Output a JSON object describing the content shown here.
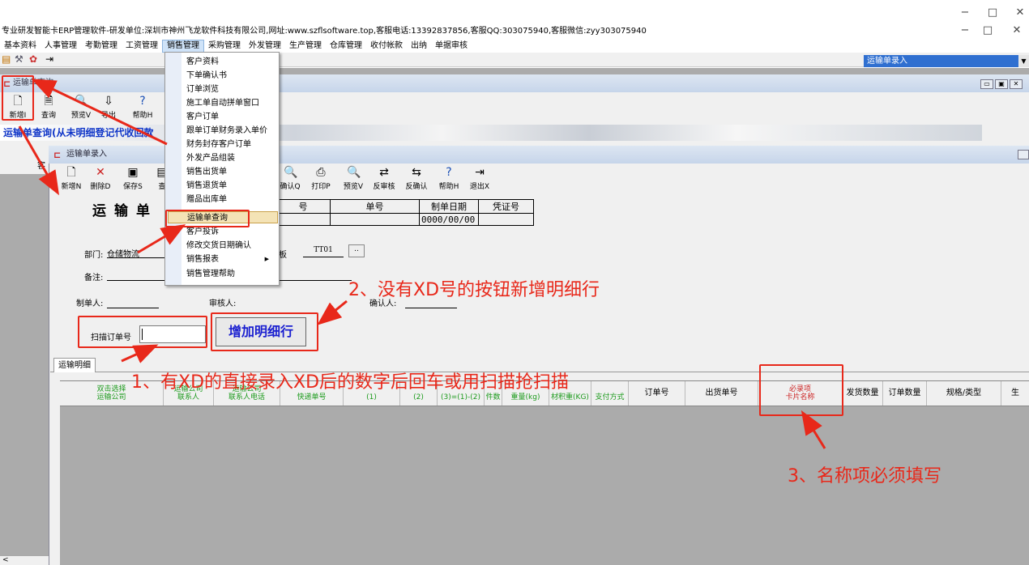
{
  "window": {
    "title": "专业研发智能卡ERP管理软件-研发单位:深圳市神州飞龙软件科技有限公司,网址:www.szflsoftware.top,客服电话:13392837856,客服QQ:303075940,客服微信:zyy303075940",
    "min": "−",
    "max": "□",
    "close": "✕"
  },
  "menubar": [
    "基本资料",
    "人事管理",
    "考勤管理",
    "工资管理",
    "销售管理",
    "采购管理",
    "外发管理",
    "生产管理",
    "仓库管理",
    "收付帐款",
    "出纳",
    "单据审核"
  ],
  "combo": "运输单录入",
  "query_window": {
    "title": "运输单查询",
    "band_text": "运输单查询(从未明细登记代收回款",
    "toolbar": [
      "新增I",
      "查询",
      "预览V",
      "导出",
      "帮助H"
    ],
    "left_header": "客"
  },
  "input_window": {
    "title": "运输单录入",
    "form_title": "运输单",
    "toolbar": [
      "新增N",
      "删除D",
      "保存S",
      "查",
      "确认Q",
      "打印P",
      "预览V",
      "反审核",
      "反确认",
      "帮助H",
      "退出X"
    ],
    "header_cols": [
      "号",
      "单号",
      "制单日期",
      "凭证号"
    ],
    "header_vals": [
      "",
      "",
      "0000/00/00",
      ""
    ],
    "dept_label": "部门:",
    "dept_value": "仓储物流",
    "template_label": "板",
    "template_value": "TT01",
    "browse": "..",
    "remark_label": "备注:",
    "maker_label": "制单人:",
    "auditor_label": "审核人:",
    "confirm_label": "确认人:",
    "scan_label": "扫描订单号",
    "add_button": "增加明细行",
    "tab": "运输明细",
    "grid_headers": [
      "双击选择\n运输公司",
      "运输公司\n联系人",
      "运输公司\n联系人电话",
      "快递单号",
      "(1)",
      "(2)",
      "(3)=(1)-(2)",
      "件数",
      "重量(kg)",
      "材积重(KG)",
      "支付方式",
      "订单号",
      "出货单号",
      "必录项\n卡片名称",
      "发货数量",
      "订单数量",
      "规格/类型",
      "生"
    ]
  },
  "menu_items": [
    "客户资料",
    "下单确认书",
    "订单浏览",
    "施工单自动拼单窗口",
    "客户订单",
    "跟单订单财务录入单价",
    "财务封存客户订单",
    "外发产品组装",
    "销售出货单",
    "销售退货单",
    "赠品出库单",
    "运输单查询",
    "客户投诉",
    "修改交货日期确认",
    "销售报表",
    "销售管理帮助"
  ],
  "menu_selected": "运输单查询",
  "annotations": {
    "note1": "1、有XD的直接录入XD后的数字后回车或用扫描抢扫描",
    "note2": "2、没有XD号的按钮新增明细行",
    "note3": "3、名称项必须填写"
  },
  "colors": {
    "annotation": "#e8281a",
    "band_text": "#1036c8",
    "selection": "#2f6fd0"
  }
}
